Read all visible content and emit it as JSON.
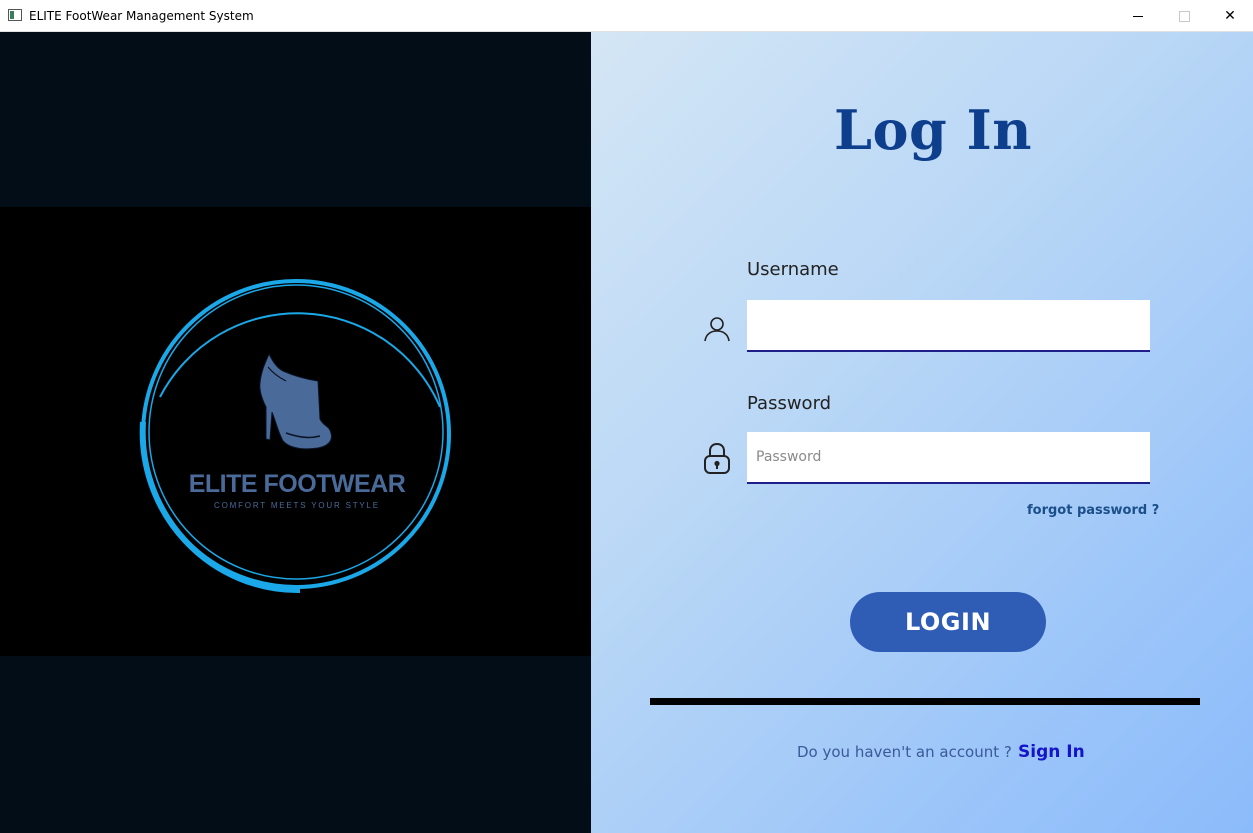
{
  "window": {
    "title": "ELITE FootWear Management System",
    "minimize_label": "",
    "maximize_label": "",
    "close_label": "✕"
  },
  "brand": {
    "name": "ELITE FOOTWEAR",
    "tagline": "COMFORT MEETS YOUR STYLE",
    "ring_color": "#1aa8e8",
    "name_color": "#4a6a9a"
  },
  "login": {
    "title": "Log In",
    "username_label": "Username",
    "username_value": "",
    "password_label": "Password",
    "password_placeholder": "Password",
    "forgot_label": "forgot password ?",
    "login_button": "LOGIN",
    "no_account_text": "Do you haven't an account ?",
    "sign_in_label": "Sign In"
  },
  "colors": {
    "title": "#0d3f8c",
    "button": "#2f5db5",
    "link": "#1414c8"
  }
}
